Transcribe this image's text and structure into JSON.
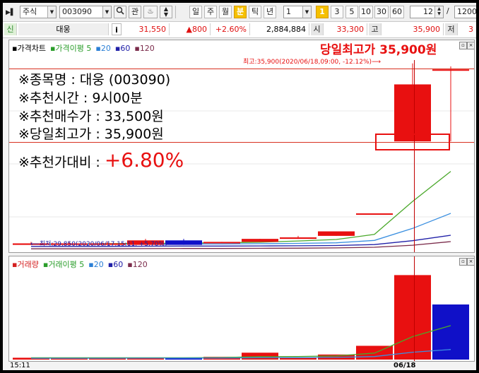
{
  "toolbar": {
    "market": "주식",
    "code": "003090",
    "search_icon": "search-icon",
    "btn_related": "관",
    "periods": [
      "일",
      "주",
      "월",
      "분",
      "틱",
      "년"
    ],
    "selected_period": "분",
    "interval": "1",
    "minute_badge": "1",
    "minute_options": [
      "3",
      "5",
      "10",
      "30",
      "60"
    ],
    "count": "12",
    "slash": "/",
    "total": "1200"
  },
  "quote": {
    "badge": "신",
    "name": "대웅",
    "info_btn": "i",
    "price": "31,550",
    "change": "▲800",
    "rate": "+2.60%",
    "volume": "2,884,884",
    "open_label": "시",
    "open": "33,300",
    "high_label": "고",
    "high": "35,900",
    "low_label": "저",
    "low": "3"
  },
  "price_pane": {
    "legend": [
      {
        "label": "가격차트",
        "color": "#000000"
      },
      {
        "label": "가격이평 5",
        "color": "#2a9d2a"
      },
      {
        "label": "20",
        "color": "#2a7fd6"
      },
      {
        "label": "60",
        "color": "#2020a8"
      },
      {
        "label": "120",
        "color": "#7a2a4a"
      }
    ],
    "headline": "당일최고가 35,900원",
    "max_note": "최고:35,900(2020/06/18,09:00, -12.12%)⟶",
    "min_note": "⟵최저:29,850(2020/06/17,15:11, +5.70%)",
    "info_lines": [
      "※종목명 : 대웅 (003090)",
      "※추천시간 : 9시00분",
      "※추천매수가 : 33,500원",
      "※당일최고가 : 35,900원"
    ],
    "ratio_label": "※추천가대비 : ",
    "ratio_value": "+6.80%"
  },
  "volume_pane": {
    "legend": [
      {
        "label": "거래량",
        "color": "#d42020"
      },
      {
        "label": "거래이평 5",
        "color": "#2a9d2a"
      },
      {
        "label": "20",
        "color": "#2a7fd6"
      },
      {
        "label": "60",
        "color": "#2020a8"
      },
      {
        "label": "120",
        "color": "#7a2a4a"
      }
    ]
  },
  "time_axis": {
    "left": "15:11",
    "center": "06/18"
  },
  "colors": {
    "up": "#e81010",
    "down": "#1010c8",
    "highlight": "#e81010"
  },
  "chart_data": {
    "type": "bar",
    "price_candles": [
      {
        "dir": "up",
        "open": 29850,
        "close": 29900,
        "high": 29950,
        "low": 29850
      },
      {
        "dir": "up",
        "open": 29850,
        "close": 29900,
        "high": 29950,
        "low": 29850
      },
      {
        "dir": "up",
        "open": 29850,
        "close": 29900,
        "high": 29950,
        "low": 29850
      },
      {
        "dir": "up",
        "open": 29850,
        "close": 30000,
        "high": 30050,
        "low": 29850
      },
      {
        "dir": "down",
        "open": 30000,
        "close": 29850,
        "high": 30050,
        "low": 29850
      },
      {
        "dir": "up",
        "open": 29900,
        "close": 29950,
        "high": 29950,
        "low": 29900
      },
      {
        "dir": "up",
        "open": 29950,
        "close": 30050,
        "high": 30050,
        "low": 29950
      },
      {
        "dir": "up",
        "open": 30050,
        "close": 30100,
        "high": 30150,
        "low": 30050
      },
      {
        "dir": "up",
        "open": 30150,
        "close": 30300,
        "high": 30300,
        "low": 30150
      },
      {
        "dir": "up",
        "open": 30900,
        "close": 30900,
        "high": 30900,
        "low": 30900
      },
      {
        "dir": "up",
        "open": 33300,
        "close": 35200,
        "high": 35900,
        "low": 33300
      },
      {
        "dir": "up",
        "open": 35700,
        "close": 35700,
        "high": 35800,
        "low": 33300
      }
    ],
    "ylim": [
      29700,
      36200
    ],
    "ma_lines": {
      "ma5": [
        29880,
        29880,
        29890,
        29900,
        29910,
        29920,
        29940,
        29980,
        30030,
        30200,
        31300,
        32300
      ],
      "ma20": [
        29870,
        29870,
        29870,
        29875,
        29880,
        29880,
        29890,
        29900,
        29920,
        30000,
        30400,
        30900
      ],
      "ma60": [
        29800,
        29800,
        29800,
        29805,
        29810,
        29810,
        29815,
        29820,
        29830,
        29860,
        29990,
        30170
      ],
      "ma120": [
        29720,
        29720,
        29720,
        29725,
        29730,
        29730,
        29735,
        29740,
        29750,
        29770,
        29840,
        29960
      ]
    },
    "volumes": [
      {
        "dir": "up",
        "v": 20000
      },
      {
        "dir": "up",
        "v": 22000
      },
      {
        "dir": "up",
        "v": 18000
      },
      {
        "dir": "up",
        "v": 21000
      },
      {
        "dir": "down",
        "v": 16000
      },
      {
        "dir": "up",
        "v": 30000
      },
      {
        "dir": "up",
        "v": 75000
      },
      {
        "dir": "up",
        "v": 25000
      },
      {
        "dir": "up",
        "v": 55000
      },
      {
        "dir": "up",
        "v": 150000
      },
      {
        "dir": "up",
        "v": 920000
      },
      {
        "dir": "down",
        "v": 600000
      }
    ],
    "vol_ylim": [
      0,
      1000000
    ],
    "vol_ma5": [
      20000,
      20000,
      20000,
      20000,
      20000,
      22000,
      32000,
      34000,
      40000,
      71000,
      250000,
      370000
    ],
    "vol_ma20": [
      15000,
      15000,
      15000,
      16000,
      16000,
      17000,
      20000,
      21000,
      24000,
      33000,
      80000,
      110000
    ]
  }
}
